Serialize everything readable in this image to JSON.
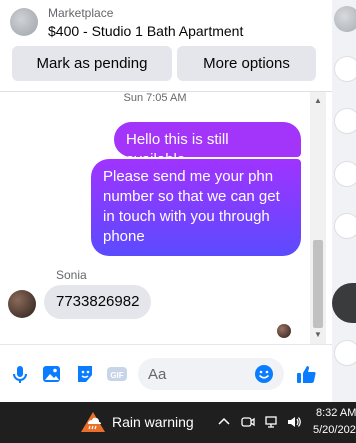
{
  "header": {
    "category": "Marketplace",
    "listing_title": "$400 - Studio 1 Bath Apartment",
    "mark_pending_label": "Mark as pending",
    "more_options_label": "More options"
  },
  "chat": {
    "timestamp": "Sun 7:05 AM",
    "outgoing": [
      "Hello this is still available",
      "Please send me your phn number so that we can get in touch with you through phone"
    ],
    "sender_name": "Sonia",
    "incoming": [
      "7733826982"
    ]
  },
  "composer": {
    "placeholder": "Aa",
    "icons": [
      "microphone-icon",
      "photo-icon",
      "sticker-icon",
      "gif-icon",
      "emoji-icon",
      "thumbs-up-icon"
    ],
    "gif_label": "GIF"
  },
  "taskbar": {
    "weather_text": "Rain warning",
    "time": "8:32 AM",
    "date": "5/20/202"
  },
  "colors": {
    "accent": "#0a7cff",
    "bubble_out_top": "#a033ff",
    "bubble_out_bottom": "#5b4bff",
    "taskbar": "#1f1f1f"
  }
}
